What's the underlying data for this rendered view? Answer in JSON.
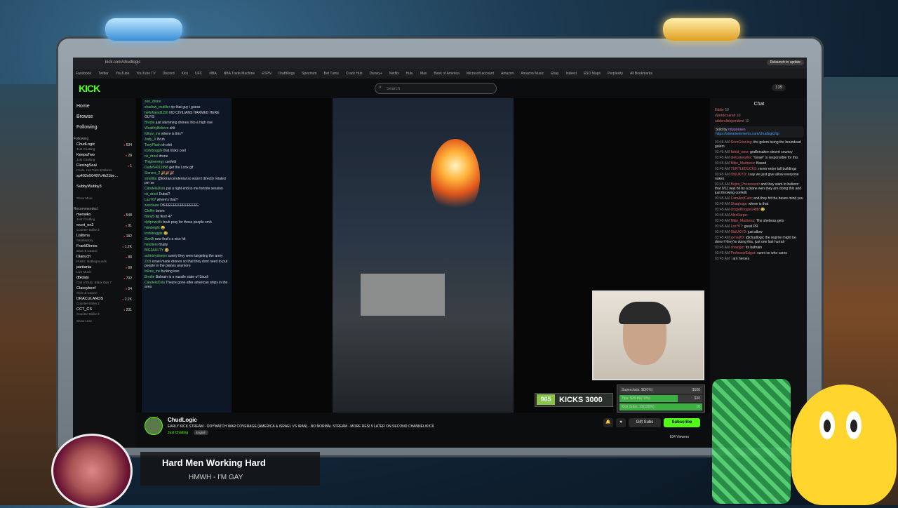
{
  "browser": {
    "url": "kick.com/chudlogic",
    "update_label": "Relaunch to update",
    "bookmarks": [
      "Facebook",
      "Twitter",
      "YouTube",
      "YouTube TV",
      "Discord",
      "Kick",
      "UFC",
      "NBA",
      "NBA Trade Machine",
      "ESPN",
      "DraftKings",
      "Spectrum",
      "Bet Turns",
      "Crack Hub",
      "Disney+",
      "Netflix",
      "Hulu",
      "Max",
      "Bank of America",
      "Microsoft account",
      "Amazon",
      "Amazon Music",
      "Ebay",
      "Indeed",
      "ESO Maps",
      "Perplexity",
      "All Bookmarks"
    ]
  },
  "header": {
    "logo": "KICK",
    "search_placeholder": "Search",
    "search_icon": "search-icon",
    "kicks_balance": "139"
  },
  "sidebar": {
    "nav": [
      "Home",
      "Browse",
      "Following"
    ],
    "following_label": "Following",
    "following": [
      {
        "name": "ChudLogic",
        "category": "Just Chatting",
        "viewers": "634"
      },
      {
        "name": "KeepaTwo",
        "category": "Just Chatting",
        "viewers": "28"
      },
      {
        "name": "FlexingSeal",
        "category": "Pools, Hot Tubs & Bikinis",
        "viewers": "1"
      },
      {
        "name": "sp402e50487c4b21be...",
        "category": "",
        "viewers": ""
      },
      {
        "name": "SubbyWubby3",
        "category": "",
        "viewers": ""
      }
    ],
    "show_more": "Show More",
    "recommended_label": "Recommended",
    "recommended": [
      {
        "name": "meowko",
        "category": "Just Chatting",
        "viewers": "548"
      },
      {
        "name": "exort_en2",
        "category": "Counter-Strike 2",
        "viewers": "91"
      },
      {
        "name": "Lislbrns",
        "category": "Satisfactory",
        "viewers": "182"
      },
      {
        "name": "FrankDimes",
        "category": "Slots & Casino",
        "viewers": "1.2K"
      },
      {
        "name": "Dianuch",
        "category": "PUBG: Battlegrounds",
        "viewers": "88"
      },
      {
        "name": "paritania",
        "category": "Live Music",
        "viewers": "69"
      },
      {
        "name": "dbldaty",
        "category": "Call of Duty: Black Ops 7",
        "viewers": "792"
      },
      {
        "name": "Classybeef",
        "category": "Slots & Casino",
        "viewers": "54"
      },
      {
        "name": "DRACULANOS",
        "category": "Counter-Strike 2",
        "viewers": "2.2K"
      },
      {
        "name": "CCT_CS",
        "category": "Counter-Strike 2",
        "viewers": "231"
      }
    ],
    "show_less": "Show Less"
  },
  "overlay_chat": [
    {
      "u": "zen_drone",
      "m": ""
    },
    {
      "u": "shadow_mutiller",
      "m": "rip that guy i guess"
    },
    {
      "u": "hellofriend1156",
      "m": "NO CIVILIANS HARMED HERE GUYS"
    },
    {
      "u": "Brodie",
      "m": "just slamming drones into a high rise"
    },
    {
      "u": "WealthyBelieve",
      "m": "shit"
    },
    {
      "u": "follow_me",
      "m": "where is this?"
    },
    {
      "u": "Jody_X",
      "m": "Bruh"
    },
    {
      "u": "TonyFlash",
      "m": "oh shit"
    },
    {
      "u": "toshiboggle",
      "m": "that looks cool"
    },
    {
      "u": "ok_drool",
      "m": "drone"
    },
    {
      "u": "Thighenergy",
      "m": "confetti"
    },
    {
      "u": "Dude54011998",
      "m": "get the Lorix gif"
    },
    {
      "u": "Sisners_2",
      "m": "🎉🎉🎉"
    },
    {
      "u": "stnotitia",
      "m": "@Extrancendental so wasn't directly related per se"
    },
    {
      "u": "CandelaDura",
      "m": "put a right end to me fortnite session"
    },
    {
      "u": "ok_drool",
      "m": "Dubai?"
    },
    {
      "u": "Laz707",
      "m": "where's that?"
    },
    {
      "u": "zenclaew",
      "m": "DIEEEEEEEEEEEEEEE"
    },
    {
      "u": "Chiffer",
      "m": "boom"
    },
    {
      "u": "Bany5",
      "m": "rip floor 47"
    },
    {
      "u": "dyfqmwolfs",
      "m": "bruh pray for those people smh"
    },
    {
      "u": "hiimbright",
      "m": "😂"
    },
    {
      "u": "toshiboggle",
      "m": "😂"
    },
    {
      "u": "Swallt",
      "m": "now that's a nice hit"
    },
    {
      "u": "hinolters",
      "m": "finally"
    },
    {
      "u": "BIGFAULTY",
      "m": "😂"
    },
    {
      "u": "actinorysleeps",
      "m": "surely they were targeting the army"
    },
    {
      "u": "Zzzt",
      "m": "israel made drones so that they dont need to put people in the planes anymore"
    },
    {
      "u": "follow_me",
      "m": "fucking iran"
    },
    {
      "u": "Brodie",
      "m": "Bahrain is a vassile state of Saudi"
    },
    {
      "u": "CandelaCola",
      "m": "Theyre gone after american ships in the area"
    }
  ],
  "stream": {
    "streamer": "ChudLogic",
    "title": "EARLY KICK STREAM - ODYWATCH WAR COVERAGE (AMERICA & ISRAEL VS IRAN) - NO NORMAL STREAM - MORE RESI 9 LATER ON SECOND CHANNEL/KICK",
    "category": "Just Chatting",
    "language": "English",
    "viewers": "634",
    "viewers_label": "Viewers",
    "gift_subs_label": "Gift Subs",
    "subscribe_label": "Subscribe"
  },
  "kicks_widget": {
    "count": "965",
    "label": "KICKS",
    "goal": "3000"
  },
  "goals_widget": [
    {
      "label": "Superchats",
      "value": "$0(0%)",
      "target": "$100",
      "fill": 0.0
    },
    {
      "label": "Tips",
      "value": "$20.89(70%)",
      "target": "$30",
      "fill": 0.7
    },
    {
      "label": "Kick Subs",
      "value": "13(130%)",
      "target": "10",
      "fill": 1.0
    }
  ],
  "chat": {
    "title": "Chat",
    "leaderboard": [
      {
        "name": "Eddie",
        "value": "50"
      },
      {
        "name": "swordicsarah",
        "value": "10"
      },
      {
        "name": "adderalldependent",
        "value": "10"
      }
    ],
    "pinned_by": "Sold by",
    "pinned_user": "mtypoosen",
    "pinned_link": "https://streamelements.com/chudlogic/tip",
    "messages": [
      {
        "t": "03:45 AM",
        "u": "GrimGrinning",
        "m": "the golem being the braindead golem"
      },
      {
        "t": "03:45 AM",
        "u": "fishtd_oreo",
        "m": "godforsaken desert country"
      },
      {
        "t": "03:45 AM",
        "u": "dietcokewifer",
        "m": "\"Israel\" is responsible for this"
      },
      {
        "t": "03:45 AM",
        "u": "Mike_Madness",
        "m": "Based"
      },
      {
        "t": "03:45 AM",
        "u": "TURTLEDUCKS",
        "m": "never enter tall buildings"
      },
      {
        "t": "03:45 AM",
        "u": "ObiUKYD",
        "m": "i say we just give allow everyone nukes"
      },
      {
        "t": "03:45 AM",
        "u": "Bojira_Possessed",
        "m": "and they want to believe that 9/11 was hit by a plane wen they are doing this and just throwing confetti"
      },
      {
        "t": "03:45 AM",
        "u": "CarsAndCats",
        "m": "and they hit the bases mind you"
      },
      {
        "t": "03:45 AM",
        "u": "Shaqhugs",
        "m": "where is that"
      },
      {
        "t": "03:45 AM",
        "u": "OogieBoogie1488",
        "m": "😂"
      },
      {
        "t": "03:45 AM",
        "u": "AlexSurpe",
        "m": ""
      },
      {
        "t": "03:45 AM",
        "u": "Mike_Madness",
        "m": "The sheboss gets"
      },
      {
        "t": "03:45 AM",
        "u": "Laz707",
        "m": "great PR"
      },
      {
        "t": "03:45 AM",
        "u": "ObiUKYD",
        "m": "just allow"
      },
      {
        "t": "03:45 AM",
        "u": "jornal2D",
        "m": "@chudlogic the regime might be done if they're doing this, just one last hurrah"
      },
      {
        "t": "03:45 AM",
        "u": "ohalogic",
        "m": "its bahrain"
      },
      {
        "t": "03:45 AM",
        "u": "ProfessorEdgar",
        "m": "sunni so who cares"
      },
      {
        "t": "03:45 AM",
        "u": "",
        "m": "arn heroes"
      }
    ]
  },
  "now_playing": {
    "title": "Hard Men Working Hard",
    "subtitle": "HMWH - I'M GAY"
  }
}
